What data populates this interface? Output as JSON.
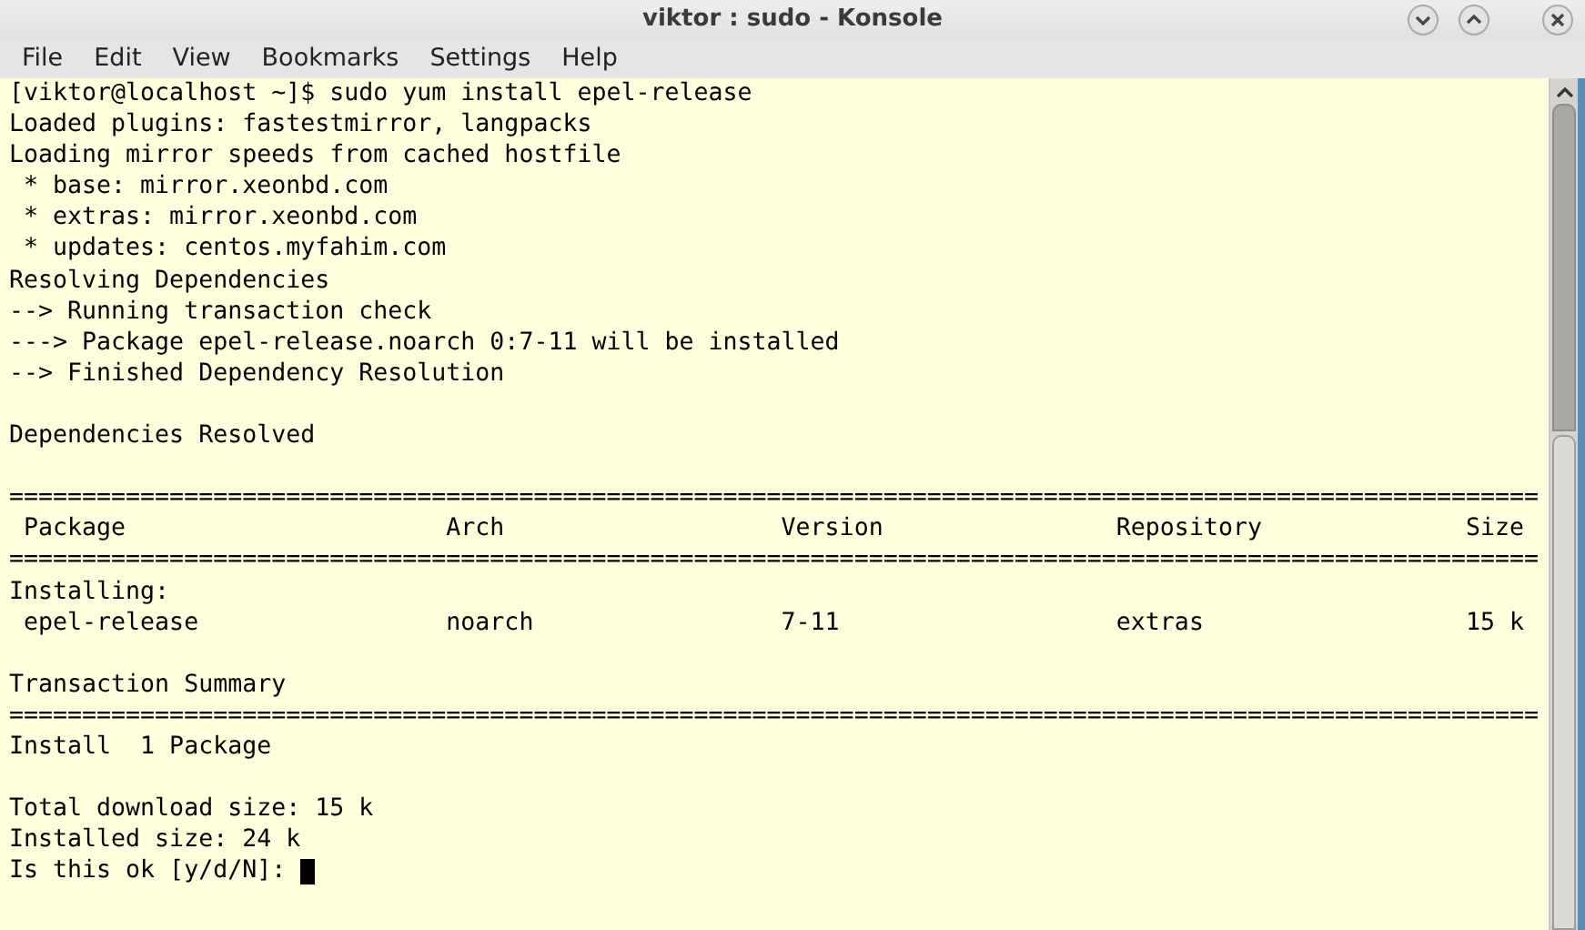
{
  "window": {
    "title": "viktor : sudo - Konsole"
  },
  "menu": [
    "File",
    "Edit",
    "View",
    "Bookmarks",
    "Settings",
    "Help"
  ],
  "terminal": {
    "cursor": true,
    "blocks": [
      [
        "[viktor@localhost ~]$ sudo yum install epel-release",
        "Loaded plugins: fastestmirror, langpacks",
        "Loading mirror speeds from cached hostfile",
        " * base: mirror.xeonbd.com",
        " * extras: mirror.xeonbd.com",
        " * updates: centos.myfahim.com",
        "Resolving Dependencies",
        "--> Running transaction check",
        "---> Package epel-release.noarch 0:7-11 will be installed",
        "--> Finished Dependency Resolution"
      ],
      [
        "Dependencies Resolved"
      ],
      [
        "=========================================================================================================",
        " Package                      Arch                   Version                Repository              Size",
        "=========================================================================================================",
        "Installing:",
        " epel-release                 noarch                 7-11                   extras                  15 k"
      ],
      [
        "Transaction Summary",
        "=========================================================================================================",
        "Install  1 Package"
      ],
      [
        "Total download size: 15 k",
        "Installed size: 24 k",
        "Is this ok [y/d/N]: "
      ]
    ]
  }
}
